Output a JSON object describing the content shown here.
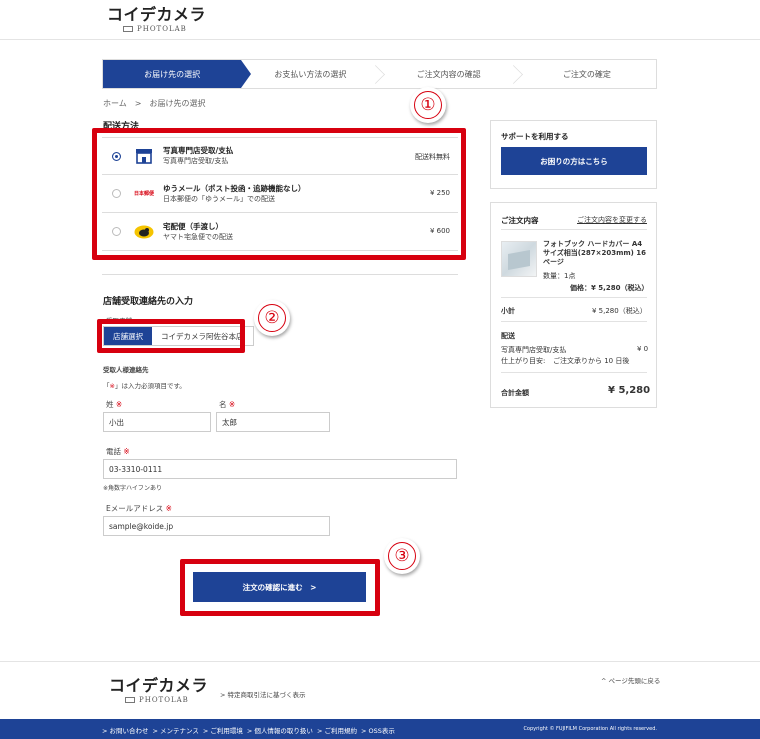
{
  "header": {
    "logo": "コイデカメラ",
    "logo_sub": "PHOTOLAB"
  },
  "steps": [
    "お届け先の選択",
    "お支払い方法の選択",
    "ご注文内容の確認",
    "ご注文の確定"
  ],
  "breadcrumb": "ホーム　>　お届け先の選択",
  "delivery": {
    "title": "配送方法",
    "options": [
      {
        "name": "写真専門店受取/支払",
        "desc": "写真専門店受取/支払",
        "price": "配送料無料",
        "selected": true,
        "icon": "shop-icon"
      },
      {
        "name": "ゆうメール（ポスト投函・追跡機能なし）",
        "desc": "日本郵便の「ゆうメール」での配送",
        "price": "¥ 250",
        "selected": false,
        "icon": "japan-post-icon",
        "icon_text": "日本郵便"
      },
      {
        "name": "宅配便（手渡し）",
        "desc": "ヤマト宅急便での配送",
        "price": "¥ 600",
        "selected": false,
        "icon": "yamato-icon"
      }
    ]
  },
  "store": {
    "title": "店舗受取連絡先の入力",
    "store_label": "受取店舗",
    "tab_active": "店舗選択",
    "tab_store": "コイデカメラ阿佐谷本店",
    "contact_label": "受取人様連絡先",
    "required_note_pre": "「",
    "required_mark": "※",
    "required_note_post": "」は入力必須項目です。",
    "last_name_label": "姓",
    "first_name_label": "名",
    "last_name": "小出",
    "first_name": "太郎",
    "phone_label": "電話",
    "phone": "03-3310-0111",
    "phone_note": "※角数字ハイフンあり",
    "email_label": "Eメールアドレス",
    "email": "sample@koide.jp",
    "submit": "注文の確認に進む　>"
  },
  "markers": [
    "①",
    "②",
    "③"
  ],
  "sidebar": {
    "support_title": "サポートを利用する",
    "help_button": "お困りの方はこちら",
    "order_title": "ご注文内容",
    "change_link": "ご注文内容を変更する",
    "product_name": "フォトブック ハードカバー A4サイズ相当(287×203mm) 16ページ",
    "qty": "数量：1点",
    "unit_price": "価格：¥ 5,280（税込）",
    "subtotal_label": "小計",
    "subtotal": "¥ 5,280（税込）",
    "shipping_label": "配送",
    "shipping_method": "写真専門店受取/支払",
    "shipping_price": "¥ 0",
    "finish_label": "仕上がり目安:",
    "finish_value": "ご注文承りから 10 日後",
    "total_label": "合計金額",
    "total": "¥ 5,280"
  },
  "footer": {
    "logo": "コイデカメラ",
    "logo_sub": "PHOTOLAB",
    "law_link": "> 特定商取引法に基づく表示",
    "page_top": "^ ページ先頭に戻る",
    "nav": [
      "> お問い合わせ",
      "> メンテナンス",
      "> ご利用環境",
      "> 個人情報の取り扱い",
      "> ご利用規約",
      "> OSS表示"
    ],
    "copyright": "Copyright © FUJIFILM Corporation All rights reserved."
  },
  "colors": {
    "primary": "#1e4396",
    "highlight": "#d7000f"
  }
}
